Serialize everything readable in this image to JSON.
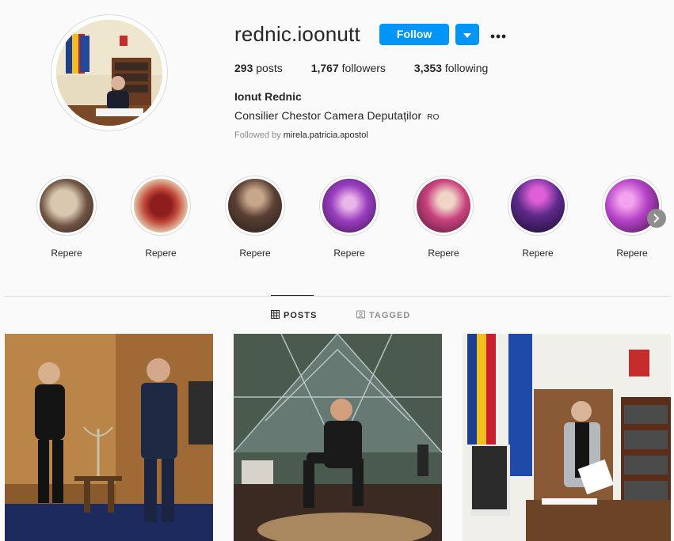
{
  "profile": {
    "username": "rednic.ioonutt",
    "follow_label": "Follow",
    "stats": {
      "posts_count": "293",
      "posts_label": "posts",
      "followers_count": "1,767",
      "followers_label": "followers",
      "following_count": "3,353",
      "following_label": "following"
    },
    "full_name": "Ionut Rednic",
    "bio": "Consilier Chestor Camera Deputaților",
    "bio_flag": "RO",
    "followed_by_prefix": "Followed by",
    "followed_by_user": "mirela.patricia.apostol"
  },
  "highlights": [
    {
      "label": "Repere"
    },
    {
      "label": "Repere"
    },
    {
      "label": "Repere"
    },
    {
      "label": "Repere"
    },
    {
      "label": "Repere"
    },
    {
      "label": "Repere"
    },
    {
      "label": "Repere"
    }
  ],
  "tabs": {
    "posts_label": "POSTS",
    "tagged_label": "TAGGED"
  },
  "icons": {
    "more": "more-options-icon",
    "dropdown": "chevron-down-icon",
    "posts_tab": "grid-icon",
    "tagged_tab": "tag-icon",
    "next": "chevron-right-icon"
  },
  "colors": {
    "accent": "#0095f6",
    "background": "#fafafa",
    "text": "#262626",
    "muted": "#8e8e8e"
  }
}
